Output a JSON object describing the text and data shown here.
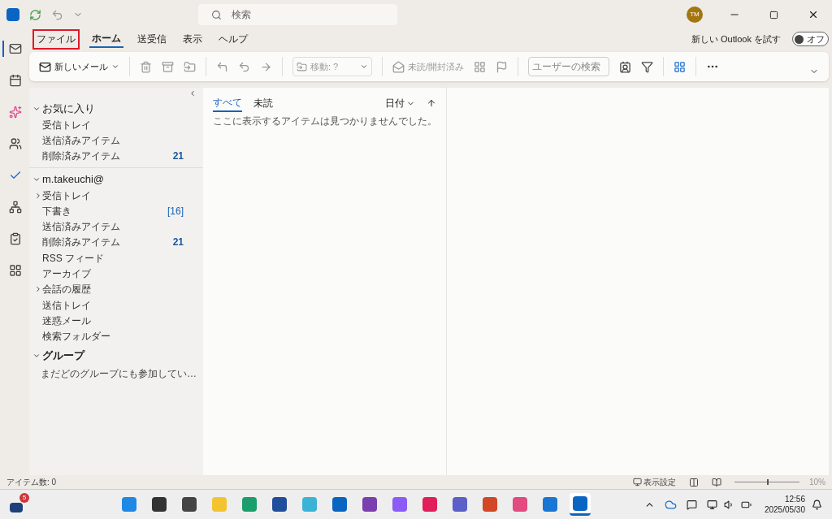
{
  "title_bar": {
    "search_placeholder": "検索",
    "avatar": "TM"
  },
  "ribbon_tabs": [
    {
      "label": "ファイル",
      "selected": false,
      "highlighted": true
    },
    {
      "label": "ホーム",
      "selected": true,
      "highlighted": false
    },
    {
      "label": "送受信",
      "selected": false,
      "highlighted": false
    },
    {
      "label": "表示",
      "selected": false,
      "highlighted": false
    },
    {
      "label": "ヘルプ",
      "selected": false,
      "highlighted": false
    }
  ],
  "try_new_outlook": {
    "label": "新しい Outlook を試す",
    "toggle_on": false,
    "toggle_label": "オフ"
  },
  "ribbon": {
    "new_mail": "新しいメール",
    "move": "移動: ?",
    "mark_read": "未読/開封済み",
    "people_search_placeholder": "ユーザーの検索"
  },
  "nav_rail": [
    {
      "kind": "mail",
      "selected": true
    },
    {
      "kind": "calendar",
      "selected": false
    },
    {
      "kind": "copilot",
      "selected": false
    },
    {
      "kind": "people",
      "selected": false
    },
    {
      "kind": "todo",
      "selected": false
    },
    {
      "kind": "groups",
      "selected": false
    },
    {
      "kind": "tasks",
      "selected": false
    },
    {
      "kind": "apps",
      "selected": false
    }
  ],
  "folder_sections": [
    {
      "title": "お気に入り",
      "expanded": true,
      "bold": false,
      "items": [
        {
          "label": "受信トレイ",
          "expandable": false
        },
        {
          "label": "送信済みアイテム",
          "expandable": false
        },
        {
          "label": "削除済みアイテム",
          "count": "21",
          "emphasized": true,
          "expandable": false
        }
      ]
    },
    {
      "title": "m.takeuchi@",
      "expanded": true,
      "bold": false,
      "items": [
        {
          "label": "受信トレイ",
          "expandable": true
        },
        {
          "label": "下書き",
          "count": "[16]",
          "emphasized": false,
          "expandable": false
        },
        {
          "label": "送信済みアイテム",
          "expandable": false
        },
        {
          "label": "削除済みアイテム",
          "count": "21",
          "emphasized": true,
          "expandable": false
        },
        {
          "label": "RSS フィード",
          "expandable": false
        },
        {
          "label": "アーカイブ",
          "expandable": false
        },
        {
          "label": "会話の履歴",
          "expandable": true
        },
        {
          "label": "送信トレイ",
          "expandable": false
        },
        {
          "label": "迷惑メール",
          "expandable": false
        },
        {
          "label": "検索フォルダー",
          "expandable": false
        }
      ]
    },
    {
      "title": "グループ",
      "expanded": true,
      "bold": true,
      "note": "まだどのグループにも参加してい…"
    }
  ],
  "message_list": {
    "tabs": [
      {
        "label": "すべて",
        "selected": true
      },
      {
        "label": "未読",
        "selected": false
      }
    ],
    "sort": "日付",
    "empty_text": "ここに表示するアイテムは見つかりませんでした。"
  },
  "status_bar": {
    "item_count": "アイテム数: 0",
    "view_settings": "表示設定",
    "zoom": {
      "level": 0.5,
      "reading": "10%"
    }
  },
  "taskbar": {
    "widget_badge": "5",
    "apps": [
      {
        "kind": "start",
        "active": false
      },
      {
        "kind": "search",
        "active": false
      },
      {
        "kind": "taskview",
        "active": false
      },
      {
        "kind": "explorer",
        "active": false
      },
      {
        "kind": "edge",
        "active": false
      },
      {
        "kind": "store",
        "active": false
      },
      {
        "kind": "circle",
        "active": false
      },
      {
        "kind": "outlook-new",
        "active": false
      },
      {
        "kind": "onenote",
        "active": false
      },
      {
        "kind": "copilot",
        "active": false
      },
      {
        "kind": "slack",
        "active": false
      },
      {
        "kind": "teams",
        "active": false
      },
      {
        "kind": "powerpoint",
        "active": false
      },
      {
        "kind": "snipping",
        "active": false
      },
      {
        "kind": "player",
        "active": false
      },
      {
        "kind": "outlook",
        "active": true
      }
    ],
    "time": "12:56",
    "date": "2025/05/30"
  }
}
